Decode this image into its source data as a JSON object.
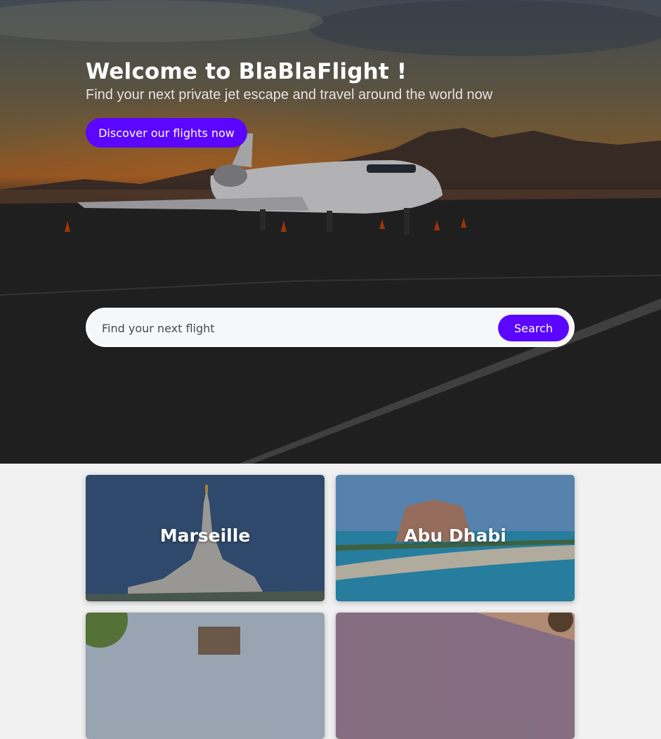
{
  "hero": {
    "title": "Welcome to BlaBlaFlight !",
    "subtitle": "Find your next private jet escape and travel around the world now",
    "cta_label": "Discover our flights now"
  },
  "search": {
    "placeholder": "Find your next flight",
    "button_label": "Search"
  },
  "destinations": [
    {
      "name": "Marseille"
    },
    {
      "name": "Abu Dhabi"
    },
    {
      "name": ""
    },
    {
      "name": ""
    }
  ],
  "colors": {
    "accent": "#5b06ff",
    "page_background": "#f1f1f2",
    "text_light": "#ffffff"
  }
}
